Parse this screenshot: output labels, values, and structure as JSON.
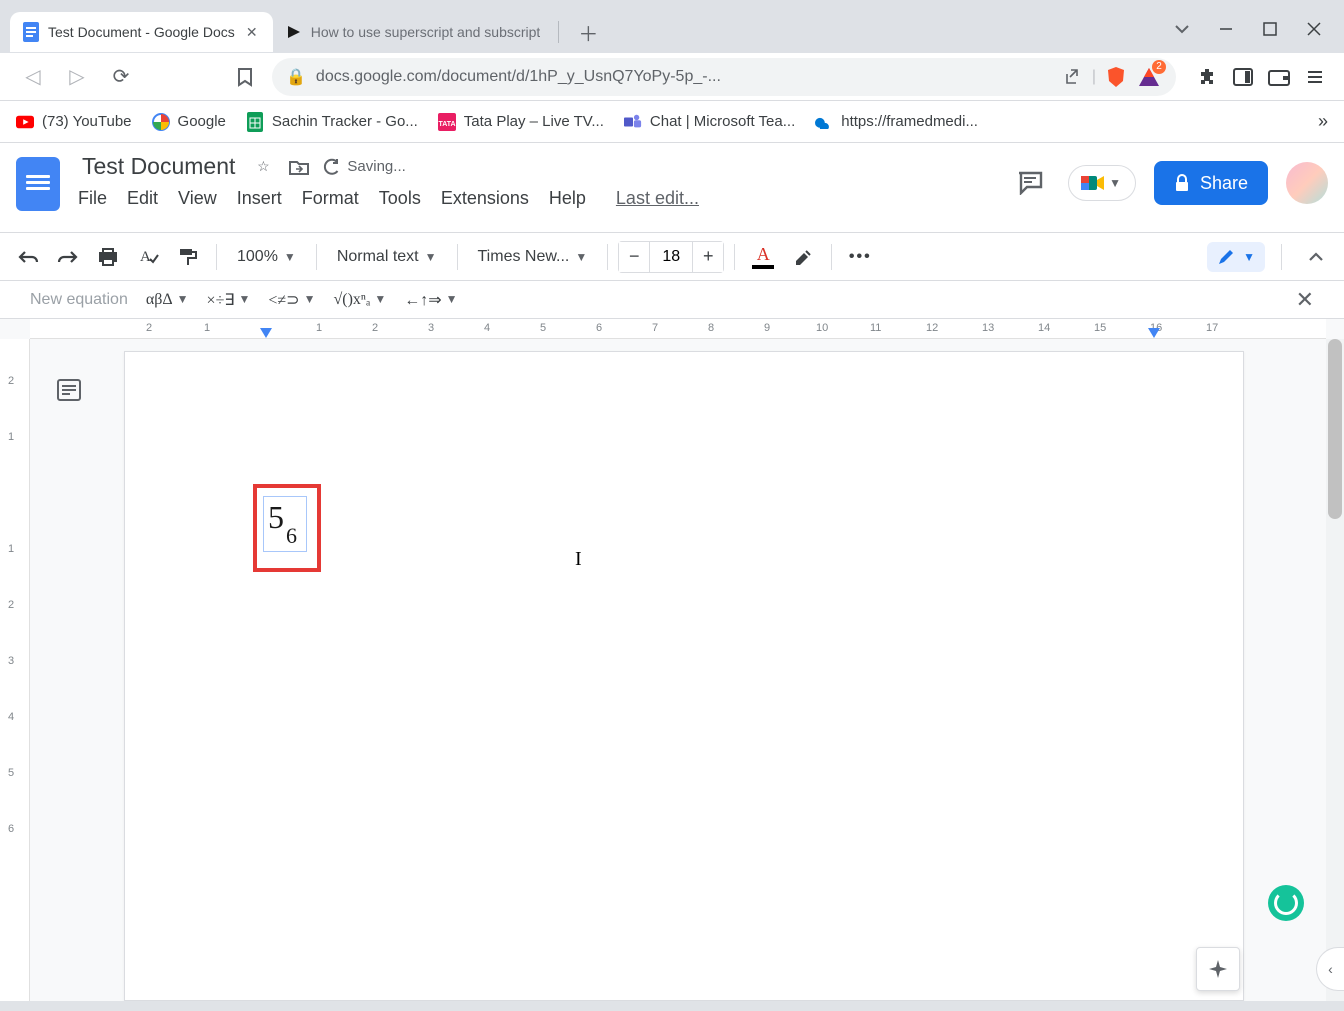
{
  "browser": {
    "tabs": [
      {
        "title": "Test Document - Google Docs",
        "active": true
      },
      {
        "title": "How to use superscript and subscript",
        "active": false
      }
    ],
    "url": "docs.google.com/document/d/1hP_y_UsnQ7YoPy-5p_-...",
    "bookmarks": [
      {
        "label": "(73) YouTube",
        "icon": "youtube"
      },
      {
        "label": "Google",
        "icon": "google"
      },
      {
        "label": "Sachin Tracker - Go...",
        "icon": "sheets"
      },
      {
        "label": "Tata Play – Live TV...",
        "icon": "tata"
      },
      {
        "label": "Chat | Microsoft Tea...",
        "icon": "teams"
      },
      {
        "label": "https://framedmedi...",
        "icon": "onedrive"
      }
    ]
  },
  "docs": {
    "title": "Test Document",
    "status": "Saving...",
    "menus": [
      "File",
      "Edit",
      "View",
      "Insert",
      "Format",
      "Tools",
      "Extensions",
      "Help"
    ],
    "last_edit": "Last edit...",
    "share_label": "Share",
    "toolbar": {
      "zoom": "100%",
      "style": "Normal text",
      "font": "Times New...",
      "font_size": "18"
    },
    "equation_toolbar": {
      "label": "New equation",
      "groups": [
        "αβΔ",
        "×÷∃",
        "<≠⊃",
        "√()xⁿₐ",
        "←↑⇒"
      ]
    },
    "document_content": {
      "equation": {
        "base": "5",
        "subscript": "6"
      }
    },
    "ruler_h": [
      "2",
      "1",
      "",
      "1",
      "2",
      "3",
      "4",
      "5",
      "6",
      "7",
      "8",
      "9",
      "10",
      "11",
      "12",
      "13",
      "14",
      "15",
      "16",
      "17"
    ],
    "ruler_v": [
      "2",
      "1",
      "",
      "1",
      "2",
      "3",
      "4",
      "5",
      "6"
    ]
  }
}
